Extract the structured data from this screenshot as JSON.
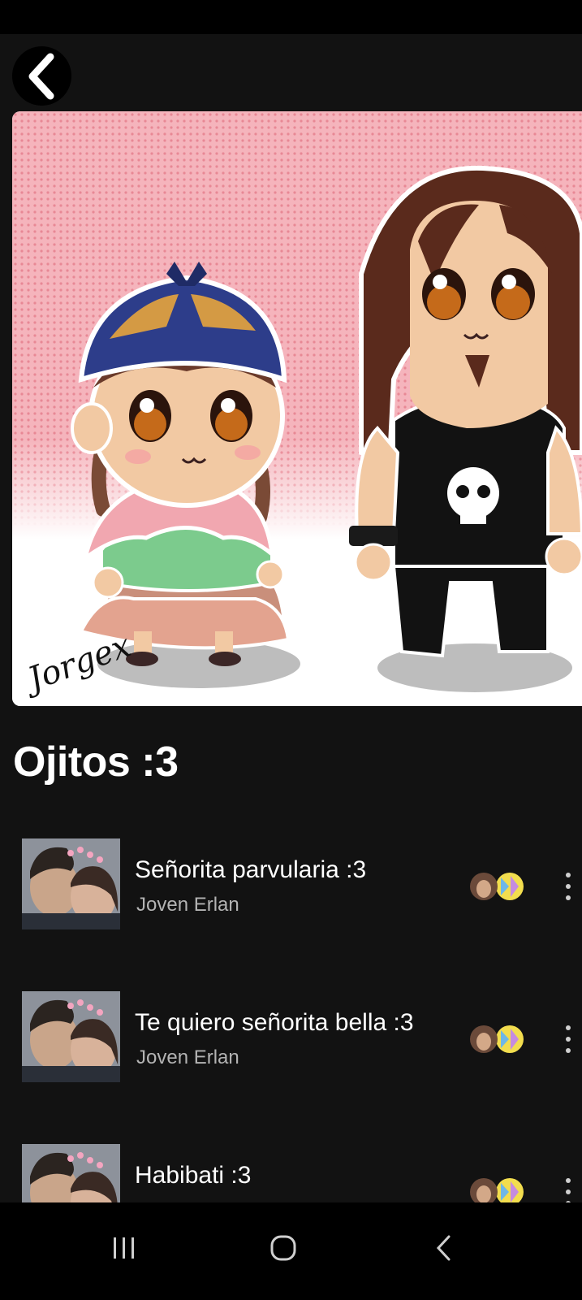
{
  "header": {
    "back_icon": "chevron-left-icon"
  },
  "cover": {
    "signature": "Jorgex",
    "bg_color": "#f4a7b0"
  },
  "playlist": {
    "title": "Ojitos :3"
  },
  "tracks": [
    {
      "title": "Señorita parvularia :3",
      "artist": "Joven Erlan"
    },
    {
      "title": "Te quiero señorita bella :3",
      "artist": "Joven Erlan"
    },
    {
      "title": "Habibati :3",
      "artist": ""
    }
  ],
  "nav": {
    "recents_icon": "recent-apps-icon",
    "home_icon": "home-icon",
    "back_icon": "back-icon"
  }
}
